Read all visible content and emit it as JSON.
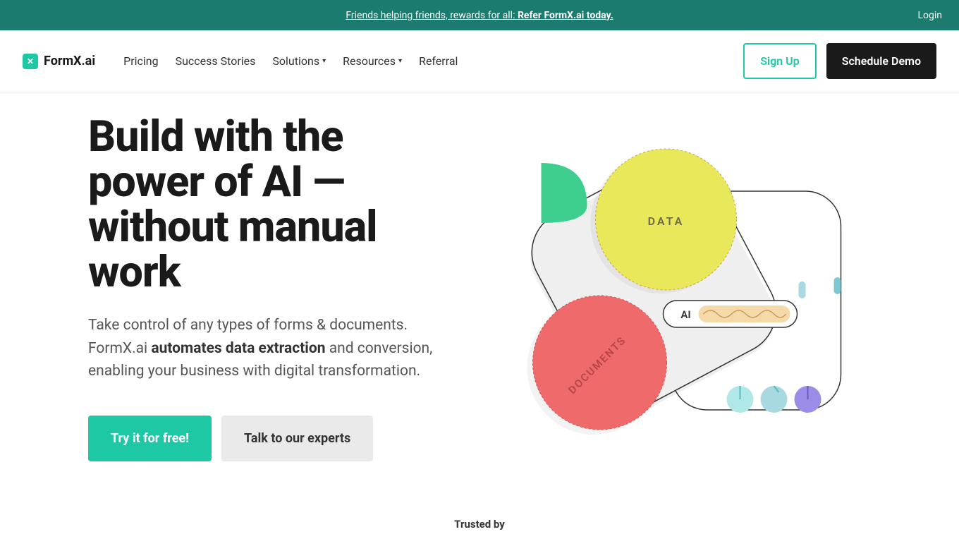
{
  "announcement": {
    "prefix": "Friends helping friends, rewards for all: ",
    "bold": "Refer FormX.ai today.",
    "login": "Login"
  },
  "logo_text": "FormX.ai",
  "nav": {
    "pricing": "Pricing",
    "success_stories": "Success Stories",
    "solutions": "Solutions",
    "resources": "Resources",
    "referral": "Referral"
  },
  "cta": {
    "sign_up": "Sign Up",
    "schedule_demo": "Schedule Demo"
  },
  "hero": {
    "title": "Build with the power of AI — without manual work",
    "desc_prefix": "Take control of any types of forms & documents. FormX.ai ",
    "desc_bold": "automates data extraction",
    "desc_suffix": " and conversion, enabling your business with digital transformation.",
    "try_free": "Try it for free!",
    "talk_experts": "Talk to our experts"
  },
  "illustration": {
    "data_label": "DATA",
    "ai_label": "AI",
    "documents_label": "DOCUMENTS"
  },
  "trusted_by": "Trusted by"
}
